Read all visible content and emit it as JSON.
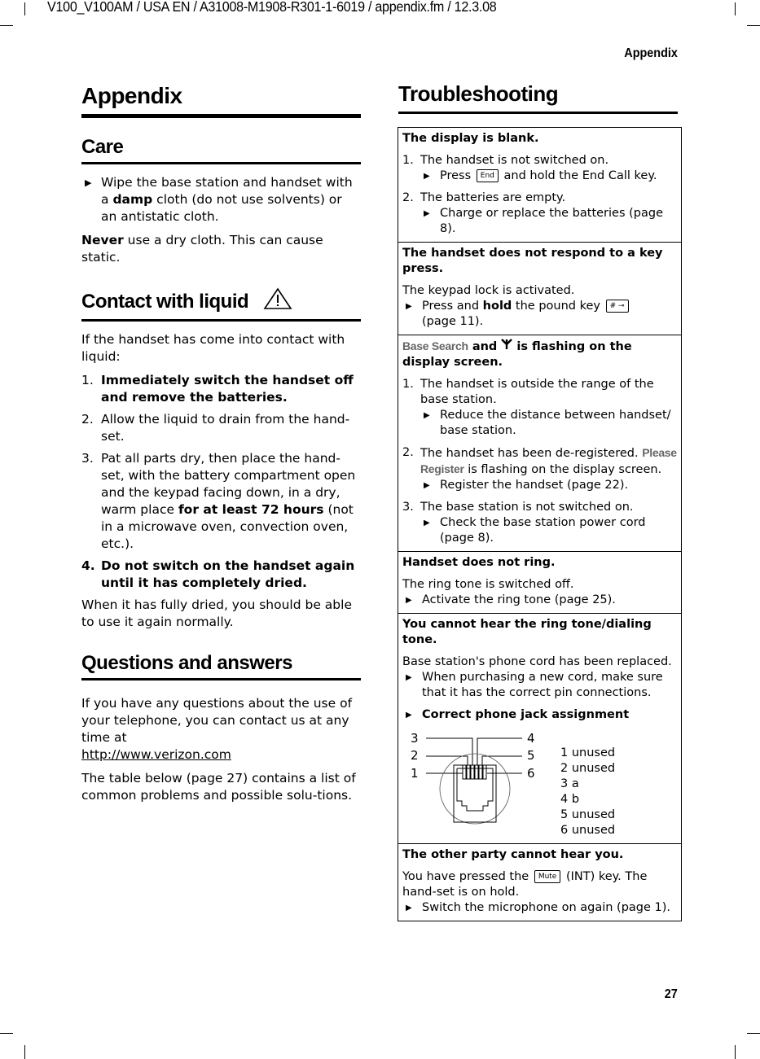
{
  "document": {
    "header_path": "V100_V100AM / USA EN / A31008-M1908-R301-1-6019 / appendix.fm / 12.3.08",
    "running_head": "Appendix",
    "page_number": "27"
  },
  "left": {
    "title": "Appendix",
    "care": {
      "heading": "Care",
      "bullet_pre": "Wipe the base station and handset with a ",
      "bullet_bold": "damp",
      "bullet_post": " cloth (do not use solvents) or an antistatic cloth.",
      "never_bold": "Never",
      "never_rest": " use a dry cloth. This can cause static."
    },
    "liquid": {
      "heading": "Contact with liquid",
      "icon": "warning-triangle-icon",
      "intro": "If the handset has come into contact with liquid:",
      "steps": [
        {
          "n": "1.",
          "bold": "Immediately switch the handset off and remove the batteries.",
          "text": ""
        },
        {
          "n": "2.",
          "bold": "",
          "text": "Allow the liquid to drain from the hand-set."
        },
        {
          "n": "3.",
          "pre": "Pat all parts dry, then place the hand-set, with the battery compartment open and the keypad facing down, in a dry, warm place ",
          "bold": "for at least 72 hours",
          "post": " (not in a microwave oven, convection oven, etc.)."
        },
        {
          "n": "4.",
          "bold": "Do not switch on the handset again until it has completely dried.",
          "text": ""
        }
      ],
      "outro": "When it has fully dried, you should be able to use it again normally."
    },
    "qa": {
      "heading": "Questions and answers",
      "intro": "If you have any questions about the use of your telephone, you can contact us at any time at",
      "link": "http://www.verizon.com",
      "table_note": "The table below (page 27) contains a list of common problems and possible solu-tions."
    }
  },
  "right": {
    "title": "Troubleshooting",
    "rows": {
      "r1": {
        "title": "The display is blank.",
        "p1_num": "1.",
        "p1": "The handset is not switched on.",
        "p1_b_pre": "Press",
        "p1_key": "End",
        "p1_b_post": "and hold the End Call key.",
        "p2_num": "2.",
        "p2": "The batteries are empty.",
        "p2_b": "Charge or replace the batteries (page 8)."
      },
      "r2": {
        "title": "The handset does not respond to a key press.",
        "cause": "The keypad lock is activated.",
        "b_pre": "Press and ",
        "b_bold": "hold",
        "b_mid": " the pound key",
        "key": "# ⊸",
        "b_post": "(page 11)."
      },
      "r3": {
        "title_disp": "Base Search",
        "title_and": " and ",
        "title_icon": "antenna-icon",
        "title_rest": " is flashing on the display screen.",
        "p1_num": "1.",
        "p1": "The handset is outside the range of the base station.",
        "p1_b": "Reduce the distance between handset/ base station.",
        "p2_num": "2.",
        "p2_pre": "The handset has been de-registered. ",
        "p2_disp": "Please Register",
        "p2_post": " is flashing on the display screen.",
        "p2_b": "Register the handset (page 22).",
        "p3_num": "3.",
        "p3": "The base station is not switched on.",
        "p3_b": "Check the base station power cord (page 8)."
      },
      "r4": {
        "title": "Handset does not ring.",
        "cause": "The ring tone is switched off.",
        "b": "Activate the ring tone (page 25)."
      },
      "r5": {
        "title": "You cannot hear the ring tone/dialing tone.",
        "cause": "Base station's phone cord has been replaced.",
        "b1": "When purchasing a new cord, make sure that it has the correct pin connections.",
        "b2": "Correct phone jack assignment",
        "jack_labels": [
          "1",
          "2",
          "3",
          "4",
          "5",
          "6"
        ],
        "pins": [
          "1 unused",
          "2 unused",
          "3 a",
          "4 b",
          "5 unused",
          "6 unused"
        ]
      },
      "r6": {
        "title": "The other party cannot hear you.",
        "cause_pre": "You have pressed the",
        "key": "Mute",
        "cause_post": "(INT) key. The hand-set is on hold.",
        "b": "Switch the microphone on again (page 1)."
      }
    }
  }
}
